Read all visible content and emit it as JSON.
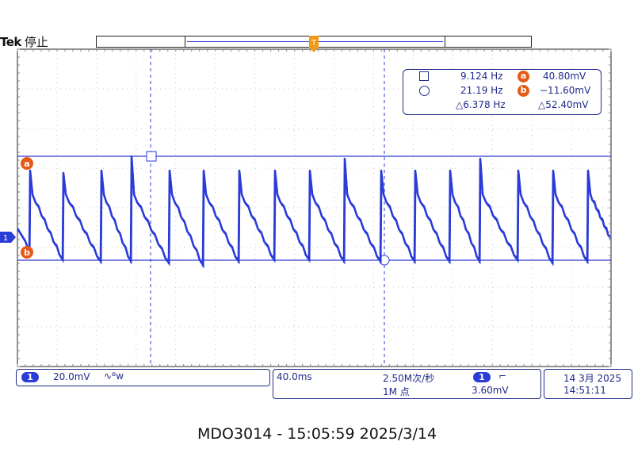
{
  "header": {
    "brand": "Tek",
    "status": "停止"
  },
  "markers": {
    "trigger_position": "T",
    "channel_marker": "1",
    "cursor_a": "a",
    "cursor_b": "b"
  },
  "measurements": {
    "freq_1": "9.124 Hz",
    "freq_2": "21.19 Hz",
    "freq_delta": "△6.378 Hz",
    "volt_a": "40.80mV",
    "volt_b": "−11.60mV",
    "volt_delta": "△52.40mV"
  },
  "channel_panel": {
    "channel": "1",
    "scale": "20.0mV",
    "coupling_symbol": "∿ᴮw"
  },
  "timebase_panel": {
    "time_per_div": "40.0ms",
    "sample_rate": "2.50M次/秒",
    "record_length": "1M 点",
    "trigger_channel": "1",
    "trigger_slope": "⌐",
    "trigger_level": "3.60mV"
  },
  "datetime_panel": {
    "date": "14 3月 2025",
    "time": "14:51:11"
  },
  "footer": {
    "caption": "MDO3014 - 15:05:59   2025/3/14"
  },
  "colors": {
    "trace": "#2b3bd8",
    "cursor_label": "#e65a17",
    "trigger_marker": "#f29a18",
    "text": "#1f2a8a"
  },
  "waveform": {
    "description_free": true,
    "cycles": [
      {
        "t": 0.42,
        "v": 0.93,
        "bottom": 0.0
      },
      {
        "t": 0.0,
        "v": 1.0
      }
    ]
  }
}
